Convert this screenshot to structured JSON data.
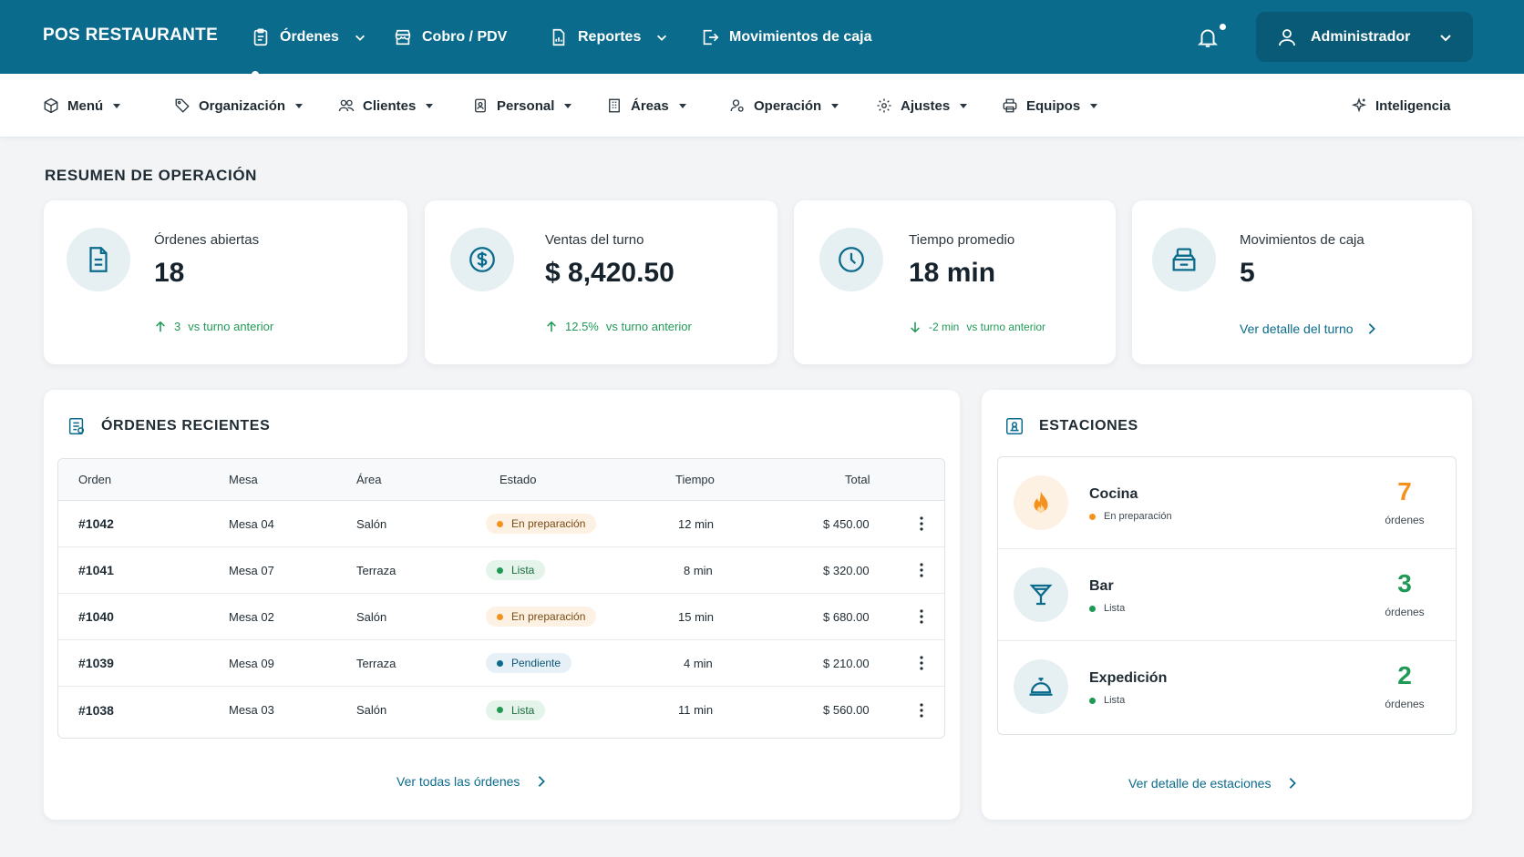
{
  "brand": "POS RESTAURANTE",
  "topnav": {
    "ordenes": "Órdenes",
    "cobro": "Cobro / PDV",
    "reportes": "Reportes",
    "movimientos": "Movimientos de caja"
  },
  "user": {
    "name": "Administrador"
  },
  "subnav": {
    "menu": "Menú",
    "organizacion": "Organización",
    "clientes": "Clientes",
    "personal": "Personal",
    "areas": "Áreas",
    "operacion": "Operación",
    "ajustes": "Ajustes",
    "equipos": "Equipos",
    "inteligencia": "Inteligencia"
  },
  "summary": {
    "title": "RESUMEN DE OPERACIÓN",
    "cards": [
      {
        "label": "Órdenes abiertas",
        "value": "18",
        "trend_value": "3",
        "trend_text": "vs turno anterior",
        "trend_dir": "up"
      },
      {
        "label": "Ventas del turno",
        "value": "$ 8,420.50",
        "trend_value": "12.5%",
        "trend_text": "vs turno anterior",
        "trend_dir": "up"
      },
      {
        "label": "Tiempo promedio",
        "value": "18 min",
        "trend_value": "-2 min",
        "trend_text": "vs turno anterior",
        "trend_dir": "down"
      },
      {
        "label": "Movimientos de caja",
        "value": "5",
        "link": "Ver detalle del turno"
      }
    ]
  },
  "orders": {
    "title": "ÓRDENES RECIENTES",
    "columns": [
      "Orden",
      "Mesa",
      "Área",
      "Estado",
      "Tiempo",
      "Total"
    ],
    "rows": [
      {
        "id": "#1042",
        "mesa": "Mesa 04",
        "area": "Salón",
        "estado": "En preparación",
        "tiempo": "12 min",
        "total": "$ 450.00"
      },
      {
        "id": "#1041",
        "mesa": "Mesa 07",
        "area": "Terraza",
        "estado": "Lista",
        "tiempo": "8 min",
        "total": "$ 320.00"
      },
      {
        "id": "#1040",
        "mesa": "Mesa 02",
        "area": "Salón",
        "estado": "En preparación",
        "tiempo": "15 min",
        "total": "$ 680.00"
      },
      {
        "id": "#1039",
        "mesa": "Mesa 09",
        "area": "Terraza",
        "estado": "Pendiente",
        "tiempo": "4 min",
        "total": "$ 210.00"
      },
      {
        "id": "#1038",
        "mesa": "Mesa 03",
        "area": "Salón",
        "estado": "Lista",
        "tiempo": "11 min",
        "total": "$ 560.00"
      }
    ],
    "link": "Ver todas las órdenes"
  },
  "stations": {
    "title": "ESTACIONES",
    "items": [
      {
        "name": "Cocina",
        "status": "En preparación",
        "count": "7",
        "unit": "órdenes",
        "color": "#f5921e"
      },
      {
        "name": "Bar",
        "status": "Lista",
        "count": "3",
        "unit": "órdenes",
        "color": "#1f9a55"
      },
      {
        "name": "Expedición",
        "status": "Lista",
        "count": "2",
        "unit": "órdenes",
        "color": "#1f9a55"
      }
    ],
    "link": "Ver detalle de estaciones"
  },
  "colors": {
    "primary": "#0b6b8c",
    "success": "#1f9a55",
    "warning": "#f5921e",
    "info": "#0b6b8c"
  }
}
